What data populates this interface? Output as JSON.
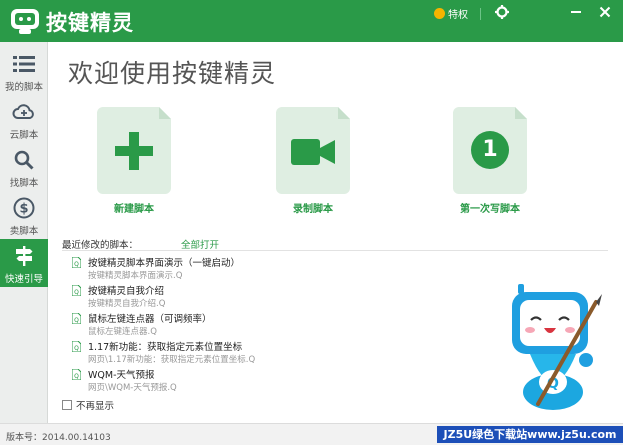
{
  "header": {
    "app_title": "按键精灵",
    "vip_label": "特权",
    "icons": [
      "settings-icon",
      "minimize-icon",
      "close-icon"
    ]
  },
  "sidebar": {
    "items": [
      {
        "label": "我的脚本",
        "icon": "list-icon",
        "active": false
      },
      {
        "label": "云脚本",
        "icon": "cloud-icon",
        "active": false
      },
      {
        "label": "找脚本",
        "icon": "search-icon",
        "active": false
      },
      {
        "label": "卖脚本",
        "icon": "dollar-icon",
        "active": false
      },
      {
        "label": "快速引导",
        "icon": "signpost-icon",
        "active": true
      }
    ]
  },
  "main": {
    "welcome": "欢迎使用按键精灵",
    "cards": [
      {
        "label": "新建脚本",
        "icon": "plus-icon"
      },
      {
        "label": "录制脚本",
        "icon": "video-camera-icon"
      },
      {
        "label": "第一次写脚本",
        "icon": "number-one-icon",
        "icon_text": "1"
      }
    ],
    "recent": {
      "title": "最近修改的脚本：",
      "open_all": "全部打开",
      "items": [
        {
          "name": "按键精灵脚本界面演示（一键启动）",
          "desc": "按键精灵脚本界面演示.Q"
        },
        {
          "name": "按键精灵自我介绍",
          "desc": "按键精灵自我介绍.Q"
        },
        {
          "name": "鼠标左键连点器（可调频率）",
          "desc": "鼠标左键连点器.Q"
        },
        {
          "name": "1.17新功能：获取指定元素位置坐标",
          "desc": "网页\\1.17新功能：获取指定元素位置坐标.Q"
        },
        {
          "name": "WQM-天气预报",
          "desc": "网页\\WQM-天气预报.Q"
        }
      ]
    },
    "no_show": "不再显示"
  },
  "footer": {
    "version": "版本号：2014.00.14103",
    "watermark": "JZ5U绿色下载站www.jz5u.com"
  },
  "colors": {
    "brand_green": "#2a9a48",
    "card_fill": "#dfeee2",
    "watermark_blue": "#1d4fb8"
  }
}
